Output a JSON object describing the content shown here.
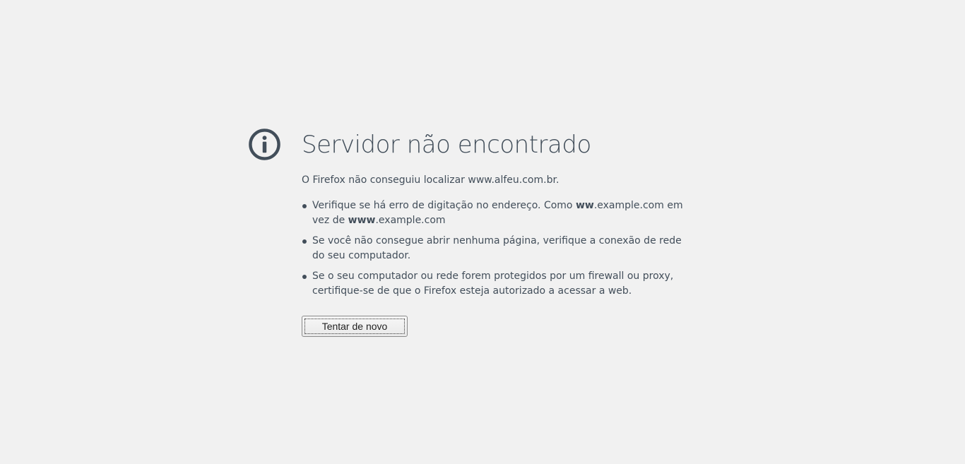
{
  "error": {
    "icon": "info-icon",
    "title": "Servidor não encontrado",
    "description": "O Firefox não conseguiu localizar www.alfeu.com.br.",
    "advice": [
      {
        "line1_pre": "Verifique se há erro de digitação no endereço. Como ",
        "line1_bold": "ww",
        "line1_post": ".example.com em",
        "line2_pre": "vez de ",
        "line2_bold": "www",
        "line2_post": ".example.com"
      },
      {
        "line1": "Se você não consegue abrir nenhuma página, verifique a conexão de rede",
        "line2": "do seu computador."
      },
      {
        "line1": "Se o seu computador ou rede forem protegidos por um firewall ou proxy,",
        "line2": "certifique-se de que o Firefox esteja autorizado a acessar a web."
      }
    ],
    "retry_label": "Tentar de novo"
  },
  "colors": {
    "background": "#f1f1f1",
    "text": "#424e5a",
    "icon": "#424e5a"
  }
}
